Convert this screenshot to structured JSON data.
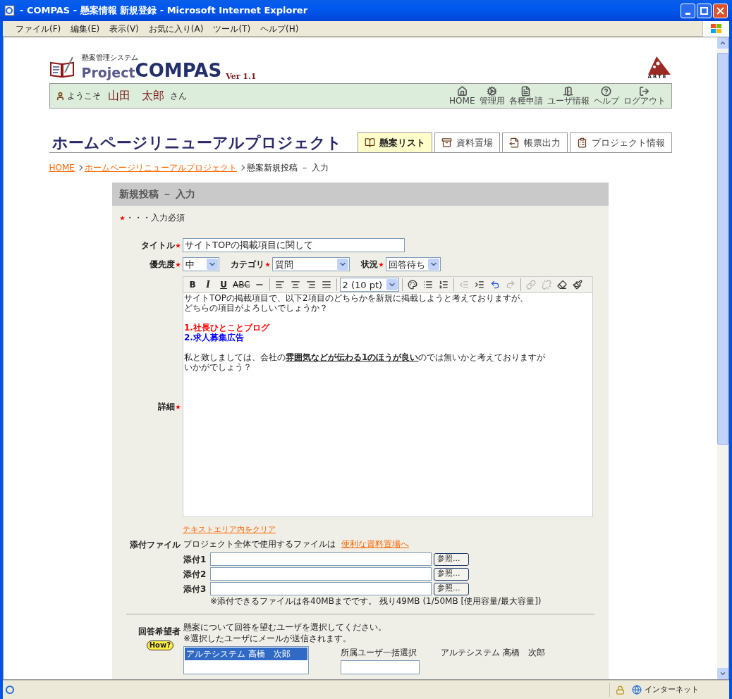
{
  "window": {
    "title": "- COMPAS - 懸案情報 新規登録 - Microsoft Internet Explorer"
  },
  "menu": [
    "ファイル(F)",
    "編集(E)",
    "表示(V)",
    "お気に入り(A)",
    "ツール(T)",
    "ヘルプ(H)"
  ],
  "logo": {
    "subtitle": "懸案管理システム",
    "prefix": "Project",
    "name": "COMPAS",
    "version": "Ver 1.1",
    "company": "ARTE"
  },
  "user_bar": {
    "greeting": "ようこそ",
    "user_name": "山田　太郎",
    "suffix": "さん",
    "nav": [
      {
        "label": "HOME"
      },
      {
        "label": "管理用"
      },
      {
        "label": "各種申請"
      },
      {
        "label": "ユーザ情報"
      },
      {
        "label": "ヘルプ"
      },
      {
        "label": "ログアウト"
      }
    ]
  },
  "project_title": "ホームページリニューアルプロジェクト",
  "tabs": [
    {
      "label": "懸案リスト",
      "selected": true
    },
    {
      "label": "資料置場",
      "selected": false
    },
    {
      "label": "帳票出力",
      "selected": false
    },
    {
      "label": "プロジェクト情報",
      "selected": false
    }
  ],
  "breadcrumb": {
    "links": [
      "HOME",
      "ホームページリニューアルプロジェクト"
    ],
    "current": "懸案新規投稿 － 入力"
  },
  "form": {
    "heading": "新規投稿 － 入力",
    "legend": "・・・入力必須",
    "title": {
      "label": "タイトル",
      "required": true,
      "value": "サイトTOPの掲載項目に関して"
    },
    "selects": [
      {
        "label": "優先度",
        "required": true,
        "value": "中"
      },
      {
        "label": "カテゴリ",
        "required": true,
        "value": "質問"
      },
      {
        "label": "状況",
        "required": true,
        "value": "回答待ち"
      }
    ],
    "detail": {
      "label": "詳細",
      "required": true,
      "toolbar": {
        "format_buttons": [
          {
            "label": "B",
            "kind": "bold"
          },
          {
            "label": "I",
            "kind": "italic"
          },
          {
            "label": "U",
            "kind": "underline"
          },
          {
            "label": "ABC",
            "kind": "strike"
          }
        ],
        "font_size": "2 (10 pt)",
        "tools": [
          {
            "disabled": false
          },
          {
            "disabled": false
          },
          {
            "disabled": false
          },
          {
            "disabled": false
          },
          {
            "disabled": false
          },
          {
            "disabled": false
          },
          {
            "disabled": false
          },
          {
            "disabled": false
          },
          {
            "disabled": true
          },
          {
            "disabled": false
          },
          {
            "disabled": false
          },
          {
            "disabled": true
          },
          {
            "disabled": true
          },
          {
            "disabled": true
          },
          {
            "disabled": false
          },
          {
            "disabled": false
          }
        ]
      },
      "blocks": [
        {
          "kind": "paragraph",
          "lines": [
            {
              "parts": [
                {
                  "text": "サイトTOPの掲載項目で、以下2項目のどちらかを新規に掲載しようと考えておりますが、",
                  "emphasis": false
                }
              ]
            },
            {
              "parts": [
                {
                  "text": "どちらの項目がよろしいでしょうか？",
                  "emphasis": false
                }
              ]
            }
          ]
        },
        {
          "kind": "list",
          "items": [
            {
              "text": "1.社長ひとことブログ",
              "color": "#ff0000"
            },
            {
              "text": "2.求人募集広告",
              "color": "#0000ff"
            }
          ]
        },
        {
          "kind": "paragraph",
          "lines": [
            {
              "parts": [
                {
                  "text": "私と致しましては、会社の",
                  "emphasis": false
                },
                {
                  "text": "雰囲気などが伝わる1のほうが良い",
                  "emphasis": true
                },
                {
                  "text": "のでは無いかと考えておりますが",
                  "emphasis": false
                }
              ]
            },
            {
              "parts": [
                {
                  "text": "いかがでしょう？",
                  "emphasis": false
                }
              ]
            }
          ]
        }
      ],
      "clear_link": "テキストエリア内をクリア"
    },
    "attachments": {
      "label": "添付ファイル",
      "intro": "プロジェクト全体で使用するファイルは",
      "link": "便利な資料置場へ",
      "files": [
        {
          "label": "添付1",
          "button": "参照..."
        },
        {
          "label": "添付2",
          "button": "参照..."
        },
        {
          "label": "添付3",
          "button": "参照..."
        }
      ],
      "note": "※添付できるファイルは各40MBまでです。 残り49MB (1/50MB [使用容量/最大容量])"
    },
    "responders": {
      "label": "回答希望者",
      "instruction": "懸案について回答を望むユーザを選択してください。",
      "note": "※選択したユーザにメールが送信されます。",
      "mascot_bubble": "How?",
      "users": [
        {
          "name": "アルテシステム 高橋　次郎",
          "selected": true
        }
      ],
      "group_select_label": "所属ユーザ一括選択",
      "chosen": "アルテシステム 高橋　次郎"
    }
  },
  "status_bar": {
    "zone": "インターネット"
  }
}
